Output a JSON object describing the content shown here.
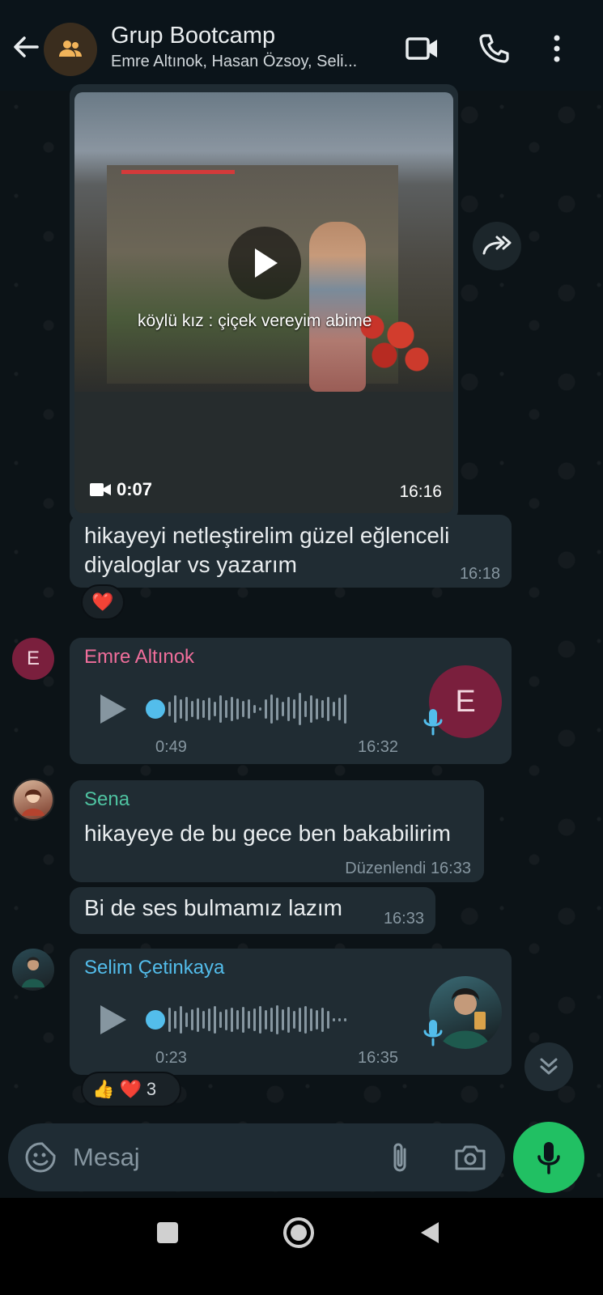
{
  "header": {
    "title": "Grup Bootcamp",
    "subtitle": "Emre Altınok, Hasan Özsoy, Seli..."
  },
  "video_message": {
    "caption": "köylü kız : çiçek vereyim abime",
    "duration": "0:07",
    "time": "16:16"
  },
  "text_message_1": {
    "text": "hikayeyi netleştirelim güzel eğlenceli diyaloglar vs yazarım",
    "time": "16:18",
    "reaction": "❤️"
  },
  "voice_message_emre": {
    "sender": "Emre Altınok",
    "avatar_letter": "E",
    "duration": "0:49",
    "time": "16:32",
    "sender_color": "#f06e9b"
  },
  "text_message_sena_1": {
    "sender": "Sena",
    "text": "hikayeye de bu gece ben bakabilirim",
    "edited_label": "Düzenlendi",
    "time": "16:33",
    "sender_color": "#4fc3a1"
  },
  "text_message_sena_2": {
    "text": "Bi de ses bulmamız lazım",
    "time": "16:33"
  },
  "voice_message_selim": {
    "sender": "Selim Çetinkaya",
    "duration": "0:23",
    "time": "16:35",
    "sender_color": "#53bdeb",
    "reaction_emojis": "👍 ❤️",
    "reaction_count": "3"
  },
  "composer": {
    "placeholder": "Mesaj"
  },
  "colors": {
    "accent_green": "#21c063",
    "bubble": "#202c33",
    "voice_dot": "#53bdeb"
  }
}
